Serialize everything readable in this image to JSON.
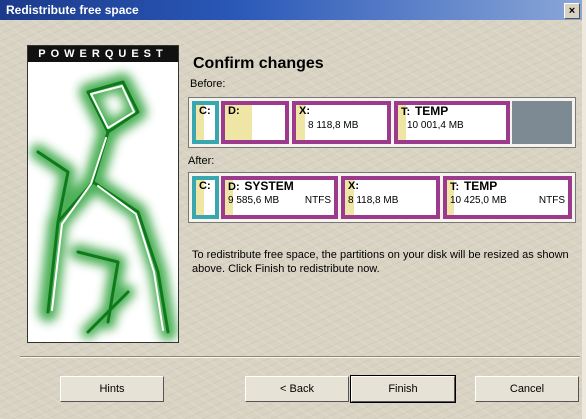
{
  "window": {
    "title": "Redistribute free space",
    "close_label": "×"
  },
  "side": {
    "brand": "POWERQUEST"
  },
  "main": {
    "heading": "Confirm changes",
    "before_label": "Before:",
    "after_label": "After:",
    "info": "To redistribute free space, the partitions on your disk will be resized as shown above. Click Finish to redistribute now."
  },
  "before": {
    "c": {
      "letter": "C:"
    },
    "d": {
      "letter": "D:"
    },
    "x": {
      "letter": "X:",
      "size": "8 118,8 MB"
    },
    "t": {
      "letter": "T:",
      "name": "TEMP",
      "size": "10 001,4 MB"
    }
  },
  "after": {
    "c": {
      "letter": "C:"
    },
    "d": {
      "letter": "D:",
      "name": "SYSTEM",
      "size": "9 585,6 MB",
      "fs": "NTFS"
    },
    "x": {
      "letter": "X:",
      "size": "8 118,8 MB"
    },
    "t": {
      "letter": "T:",
      "name": "TEMP",
      "size": "10 425,0 MB",
      "fs": "NTFS"
    }
  },
  "buttons": {
    "hints": "Hints",
    "back": "< Back",
    "finish": "Finish",
    "cancel": "Cancel"
  },
  "colors": {
    "teal_partition": "#3aa6b0",
    "purple_partition": "#9c3b8e",
    "gray_partition": "#7d8a93",
    "used_space": "#efe6a6",
    "brand_green": "#1f9a2a"
  }
}
